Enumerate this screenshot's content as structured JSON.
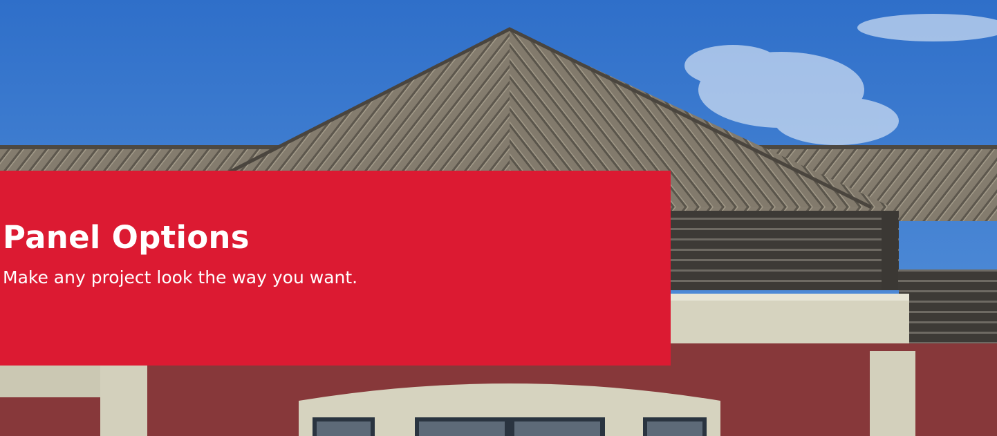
{
  "hero": {
    "title": "Panel Options",
    "subtitle": "Make any project look the way you want.",
    "background_image": "metal-roof-building-photo"
  },
  "colors": {
    "card": "#dc1a32",
    "text": "#ffffff",
    "sky": "#3d7ed1",
    "roof": "#7d7566",
    "wall": "#8a3a3a",
    "trim": "#d8d6c5"
  }
}
